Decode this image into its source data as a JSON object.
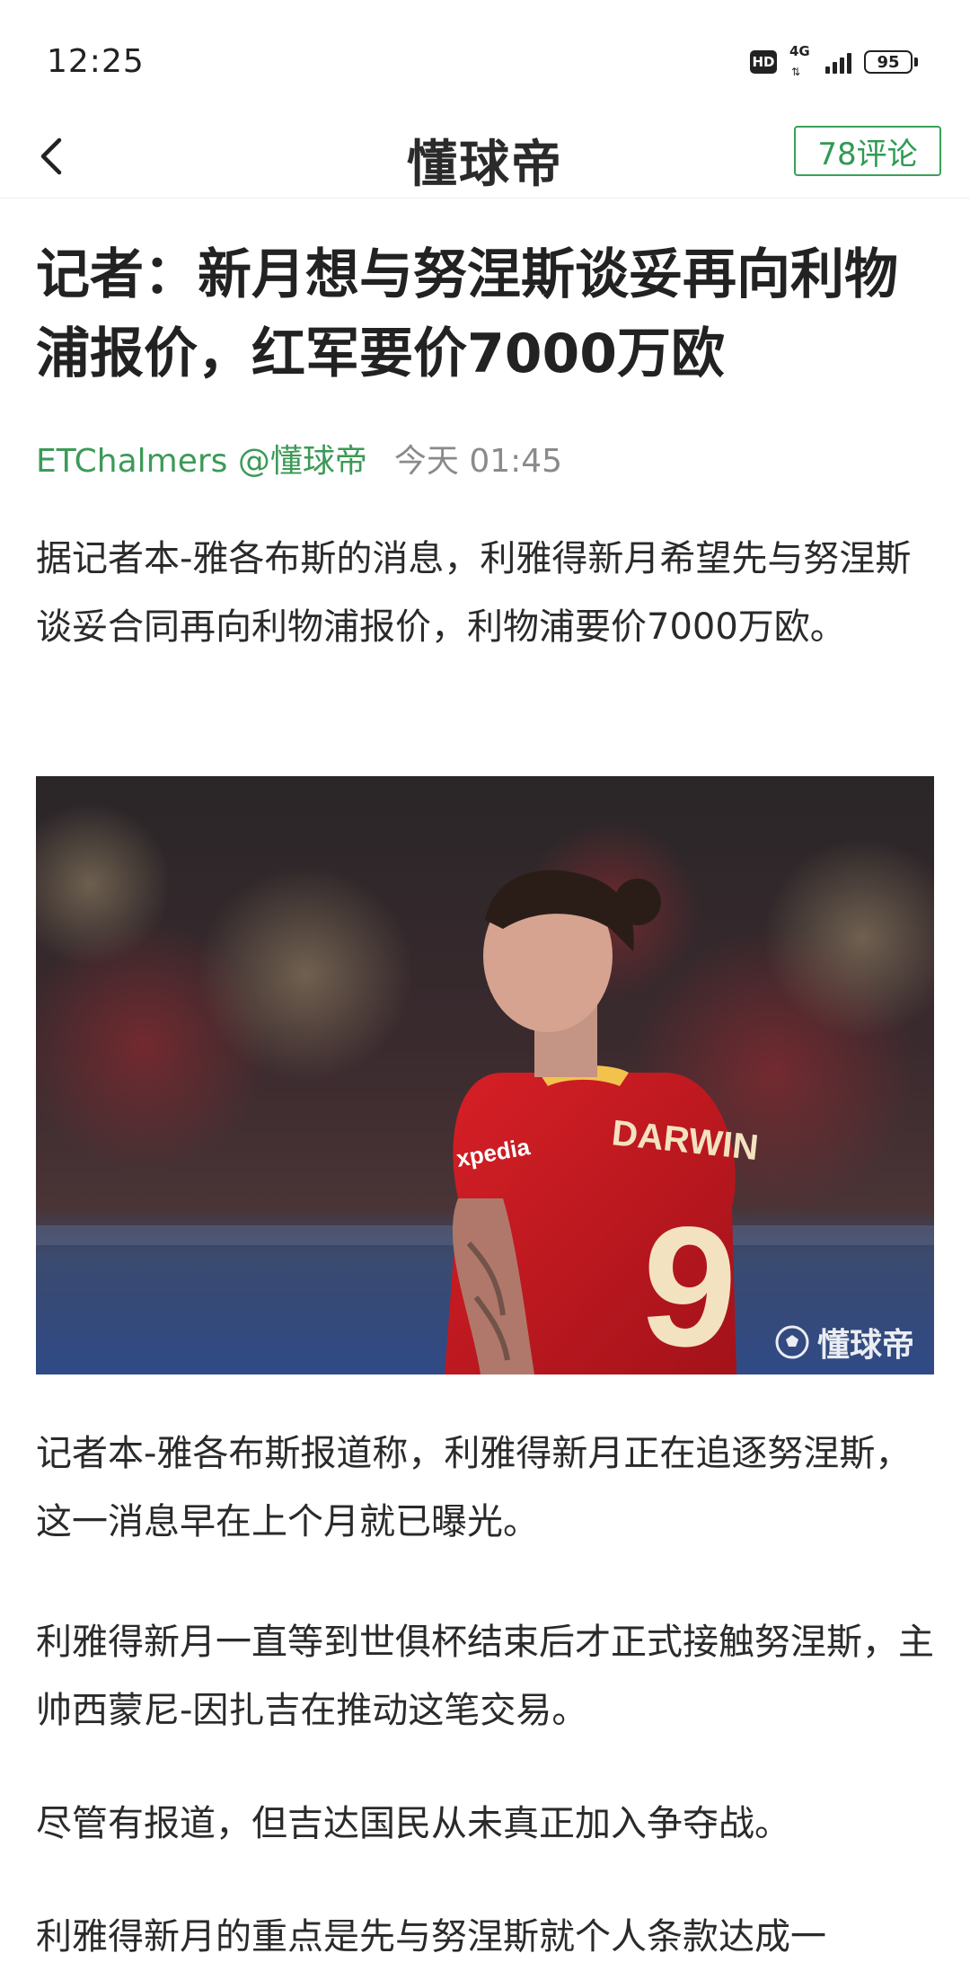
{
  "status_bar": {
    "time": "12:25",
    "hd_label": "HD",
    "network": "4G",
    "battery": "95"
  },
  "nav": {
    "brand": "懂球帝",
    "comments": "78评论"
  },
  "article": {
    "title": "记者：新月想与努涅斯谈妥再向利物浦报价，红军要价7000万欧",
    "author": "ETChalmers @懂球帝",
    "time": "今天 01:45",
    "paragraphs": [
      "据记者本-雅各布斯的消息，利雅得新月希望先与努涅斯谈妥合同再向利物浦报价，利物浦要价7000万欧。",
      "记者本-雅各布斯报道称，利雅得新月正在追逐努涅斯，这一消息早在上个月就已曝光。",
      "利雅得新月一直等到世俱杯结束后才正式接触努涅斯，主帅西蒙尼-因扎吉在推动这笔交易。",
      "尽管有报道，但吉达国民从未真正加入争夺战。",
      "利雅得新月的重点是先与努涅斯就个人条款达成一"
    ],
    "image": {
      "jersey_name": "DARWIN",
      "jersey_number": "9",
      "sponsor": "xpedia",
      "watermark": "懂球帝"
    }
  },
  "colors": {
    "accent_green": "#3aa05a",
    "jersey_red": "#c8161d"
  }
}
